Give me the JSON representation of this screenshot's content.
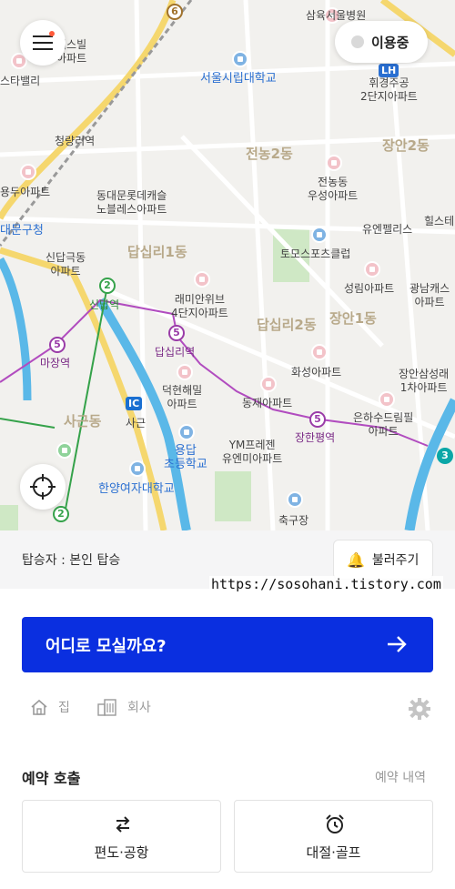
{
  "map": {
    "districts": [
      "전농2동",
      "장안2동",
      "답십리1동",
      "답십리2동",
      "장안1동",
      "사근동"
    ],
    "labels": [
      "삼육서울병원",
      "서울시립대학교",
      "휘경주공\n2단지아파트",
      "청량리역",
      "동대문롯데캐슬\n노블레스아파트",
      "전농동\n우성아파트",
      "유엔펠리스",
      "토모스포츠클럽",
      "신답극동\n아파트",
      "래미안위브\n4단지아파트",
      "성림아파트",
      "광남캐스\n아파트",
      "화성아파트",
      "장안삼성래\n1차아파트",
      "덕현해밀\n아파트",
      "동재아파트",
      "은하수드림필\n아파트",
      "YM프레젠\n유엔미아파트",
      "용답\n초등학교",
      "한양여자대학교",
      "축구장",
      "용두아파트",
      "대문구청",
      "캐스빌\n아파트",
      "스타밸리",
      "힐스테"
    ],
    "stations": [
      "마장역",
      "신답역",
      "답십리역",
      "장한평역"
    ],
    "line_numbers": [
      "5",
      "2",
      "6",
      "3"
    ],
    "ic_label": "IC",
    "sagun": "사근",
    "lh_label": "LH"
  },
  "header": {
    "status_label": "이용중"
  },
  "rider": {
    "text": "탑승자 : 본인 탑승",
    "call_button": "불러주기"
  },
  "watermark": "https://sosohani.tistory.com",
  "destination": {
    "label": "어디로 모실까요?"
  },
  "shortcuts": {
    "home": "집",
    "office": "회사"
  },
  "reserve": {
    "title": "예약 호출",
    "history_link": "예약 내역",
    "cards": [
      {
        "label": "편도·공항",
        "icon": "swap-arrows-icon"
      },
      {
        "label": "대절·골프",
        "icon": "alarm-clock-icon"
      }
    ]
  },
  "colors": {
    "primary": "#0a2fe0",
    "line5": "#9a3ca8",
    "line2": "#35a24a",
    "river": "#5ab8e8",
    "road_yellow": "#f5d76e"
  }
}
